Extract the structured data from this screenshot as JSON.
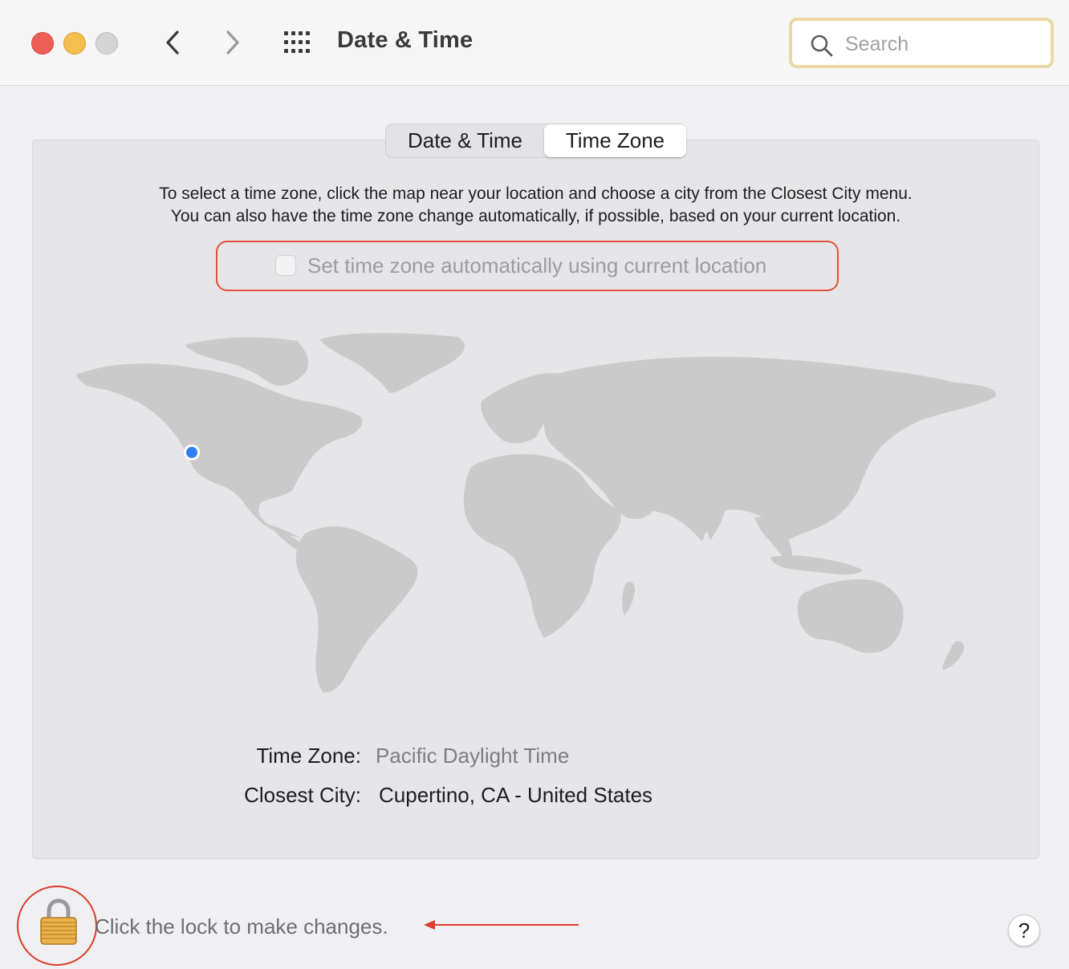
{
  "window": {
    "title": "Date & Time",
    "controls": {
      "close": "close-icon",
      "minimize": "minimize-icon",
      "zoom": "zoom-icon"
    },
    "nav": {
      "back_icon": "chevron-left-icon",
      "forward_icon": "chevron-right-icon",
      "grid_icon": "grid-icon"
    }
  },
  "search": {
    "placeholder": "Search",
    "icon": "search-icon"
  },
  "tabs": [
    {
      "label": "Date & Time",
      "selected": false
    },
    {
      "label": "Time Zone",
      "selected": true
    }
  ],
  "instructions": {
    "line1": "To select a time zone, click the map near your location and choose a city from the Closest City menu.",
    "line2": "You can also have the time zone change automatically, if possible, based on your current location."
  },
  "auto_timezone": {
    "label": "Set time zone automatically using current location",
    "checked": false,
    "enabled": false
  },
  "map": {
    "marker_icon": "location-dot-icon",
    "marker_color": "#2f7ff5",
    "land_color": "#cacaca"
  },
  "timezone": {
    "label": "Time Zone:",
    "value": "Pacific Daylight Time"
  },
  "closest_city": {
    "label": "Closest City:",
    "value": "Cupertino, CA - United States"
  },
  "lock": {
    "icon": "lock-icon",
    "text": "Click the lock to make changes."
  },
  "help": {
    "label": "?"
  },
  "annotation_color": "#dd3b2b"
}
